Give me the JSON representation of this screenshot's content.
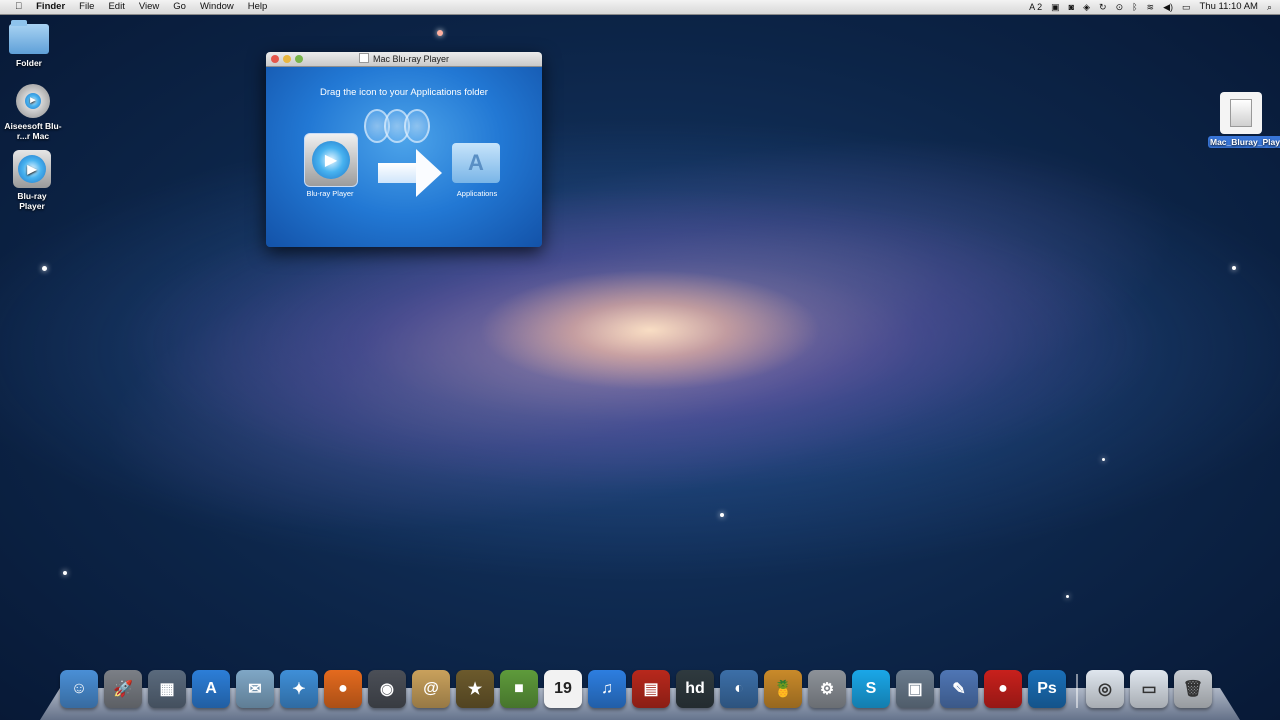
{
  "menubar": {
    "apple": "",
    "items": [
      "Finder",
      "File",
      "Edit",
      "View",
      "Go",
      "Window",
      "Help"
    ],
    "status": {
      "badge": "A 2",
      "clock": "Thu 11:10 AM"
    }
  },
  "desktop": {
    "icons": [
      {
        "label": "Folder",
        "kind": "folder"
      },
      {
        "label": "Aiseesoft Blu-r...r Mac",
        "kind": "app"
      },
      {
        "label": "Blu-ray Player",
        "kind": "app"
      },
      {
        "label": "Mac_Bluray_Player.dmg",
        "kind": "dmg"
      }
    ]
  },
  "window": {
    "title": "Mac Blu-ray Player",
    "instruction": "Drag the icon to your Applications folder",
    "app_label": "Blu-ray Player",
    "target_label": "Applications"
  },
  "dock": {
    "items": [
      {
        "name": "finder",
        "glyph": "☺",
        "color": "#4a8fd6"
      },
      {
        "name": "launchpad",
        "glyph": "🚀",
        "color": "#7b7f86"
      },
      {
        "name": "mission-control",
        "glyph": "▦",
        "color": "#5a6a7d"
      },
      {
        "name": "app-store",
        "glyph": "A",
        "color": "#2c7ed8"
      },
      {
        "name": "mail",
        "glyph": "✉",
        "color": "#7fa7c6"
      },
      {
        "name": "safari",
        "glyph": "✦",
        "color": "#3f8fd8"
      },
      {
        "name": "firefox",
        "glyph": "●",
        "color": "#e46a1e"
      },
      {
        "name": "facetime",
        "glyph": "◉",
        "color": "#4b4f57"
      },
      {
        "name": "contacts",
        "glyph": "@",
        "color": "#c9a15c"
      },
      {
        "name": "imovie",
        "glyph": "★",
        "color": "#6c5a2c"
      },
      {
        "name": "minecraft",
        "glyph": "■",
        "color": "#5e9b3b"
      },
      {
        "name": "calendar",
        "glyph": "19",
        "color": "#e8e8e8"
      },
      {
        "name": "itunes",
        "glyph": "♫",
        "color": "#2d7ee0"
      },
      {
        "name": "photo-booth",
        "glyph": "▤",
        "color": "#b8281c"
      },
      {
        "name": "hd-player",
        "glyph": "hd",
        "color": "#2f3a3f"
      },
      {
        "name": "preview",
        "glyph": "◐",
        "color": "#3c6fa8"
      },
      {
        "name": "drinks",
        "glyph": "🍍",
        "color": "#c98a2a"
      },
      {
        "name": "system-preferences",
        "glyph": "⚙",
        "color": "#8d9299"
      },
      {
        "name": "skype",
        "glyph": "S",
        "color": "#1aa7e8"
      },
      {
        "name": "iphoto",
        "glyph": "▣",
        "color": "#6a7b8d"
      },
      {
        "name": "pen-tool",
        "glyph": "✎",
        "color": "#4f76b5"
      },
      {
        "name": "red-ball",
        "glyph": "●",
        "color": "#c8201c"
      },
      {
        "name": "photoshop",
        "glyph": "Ps",
        "color": "#1a6fb8"
      }
    ],
    "right_items": [
      {
        "name": "applications-stack",
        "glyph": "◎",
        "color": "#dfe6ee"
      },
      {
        "name": "downloads-stack",
        "glyph": "▭",
        "color": "#dfe6ee"
      },
      {
        "name": "trash",
        "glyph": "🗑",
        "color": "#c9ced4"
      }
    ]
  }
}
